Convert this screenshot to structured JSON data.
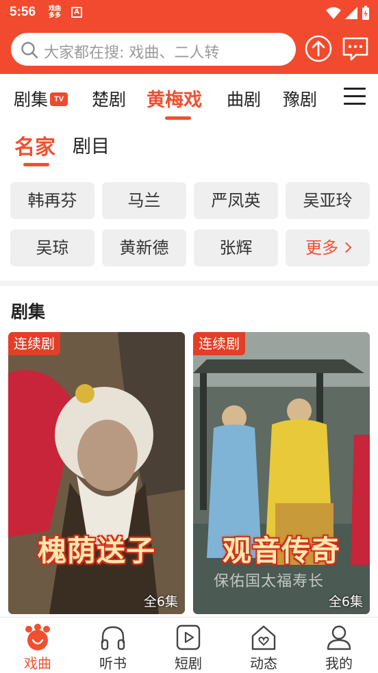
{
  "status_bar": {
    "time": "5:56",
    "app_badge_line1": "戏曲",
    "app_badge_line2": "多多",
    "store_badge": "A"
  },
  "search": {
    "placeholder": "大家都在搜: 戏曲、二人转"
  },
  "category_tabs": [
    {
      "label": "剧集",
      "badge": "TV"
    },
    {
      "label": "楚剧"
    },
    {
      "label": "黄梅戏",
      "active": true
    },
    {
      "label": "曲剧"
    },
    {
      "label": "豫剧"
    }
  ],
  "sub_tabs": [
    {
      "label": "名家",
      "active": true
    },
    {
      "label": "剧目"
    }
  ],
  "artists": [
    "韩再芬",
    "马兰",
    "严凤英",
    "吴亚玲",
    "吴琼",
    "黄新德",
    "张辉"
  ],
  "more_label": "更多",
  "section": {
    "title": "剧集",
    "cards": [
      {
        "badge": "连续剧",
        "title": "槐荫送子",
        "episodes": "全6集"
      },
      {
        "badge": "连续剧",
        "title": "观音传奇",
        "subtitle": "保佑国太福寿长",
        "episodes": "全6集"
      }
    ]
  },
  "bottom_nav": [
    {
      "label": "戏曲",
      "icon": "opera-icon",
      "active": true
    },
    {
      "label": "听书",
      "icon": "headphones-icon"
    },
    {
      "label": "短剧",
      "icon": "play-icon"
    },
    {
      "label": "动态",
      "icon": "home-heart-icon"
    },
    {
      "label": "我的",
      "icon": "user-icon"
    }
  ],
  "colors": {
    "brand": "#f24a2e",
    "accent": "#f0502f",
    "chip_bg": "#efefef"
  }
}
